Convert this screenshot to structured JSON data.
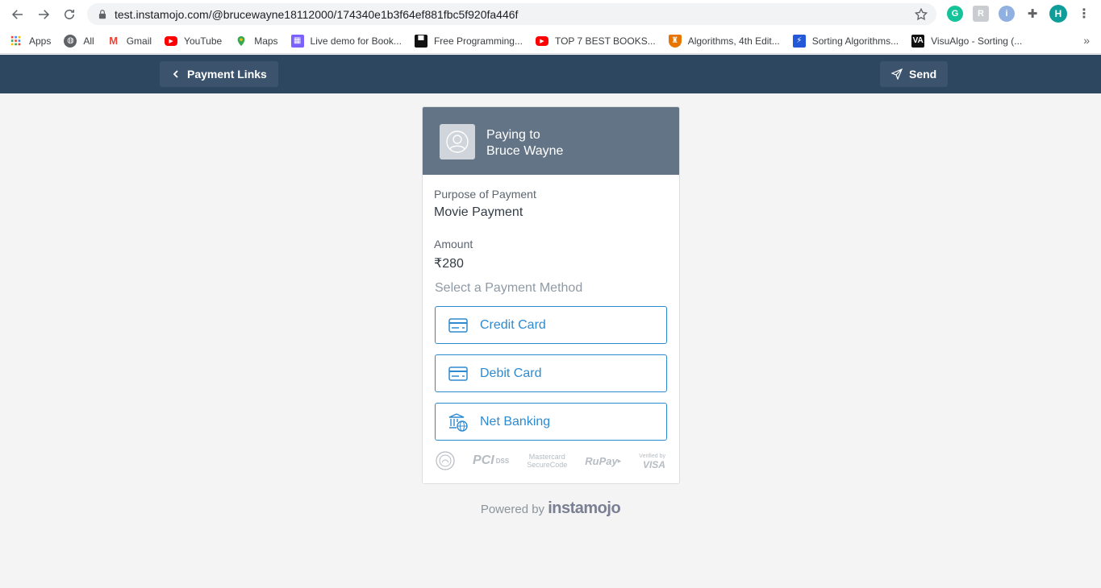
{
  "browser": {
    "url": "test.instamojo.com/@brucewayne18112000/174340e1b3f64ef881fbc5f920fa446f",
    "profile_initial": "H",
    "bookmarks": [
      {
        "label": "Apps",
        "icon": "apps-grid-icon"
      },
      {
        "label": "All",
        "icon": "globe-icon"
      },
      {
        "label": "Gmail",
        "icon": "gmail-icon"
      },
      {
        "label": "YouTube",
        "icon": "youtube-icon"
      },
      {
        "label": "Maps",
        "icon": "maps-pin-icon"
      },
      {
        "label": "Live demo for Book...",
        "icon": "calendar-icon"
      },
      {
        "label": "Free Programming...",
        "icon": "square-logo-icon"
      },
      {
        "label": "TOP 7 BEST BOOKS...",
        "icon": "youtube-icon"
      },
      {
        "label": "Algorithms, 4th Edit...",
        "icon": "shield-icon"
      },
      {
        "label": "Sorting Algorithms...",
        "icon": "bookmark-blue-icon"
      },
      {
        "label": "VisuAlgo - Sorting (...",
        "icon": "visualgo-icon"
      }
    ],
    "more_symbol": "»"
  },
  "header": {
    "back_label": "Payment Links",
    "send_label": "Send"
  },
  "card": {
    "paying_to_line1": "Paying to",
    "paying_to_line2": "Bruce Wayne",
    "purpose_label": "Purpose of Payment",
    "purpose_value": "Movie Payment",
    "amount_label": "Amount",
    "amount_currency": "₹",
    "amount_value": "280",
    "select_method_label": "Select a Payment Method",
    "methods": [
      {
        "label": "Credit Card",
        "icon": "credit-card-icon"
      },
      {
        "label": "Debit Card",
        "icon": "debit-card-icon"
      },
      {
        "label": "Net Banking",
        "icon": "bank-globe-icon"
      }
    ],
    "badges": {
      "pci": "PCI",
      "pci_dss": "DSS",
      "mastercard_line1": "Mastercard",
      "mastercard_line2": "SecureCode",
      "rupay": "RuPay",
      "visa_line1": "Verified by",
      "visa_line2": "VISA"
    }
  },
  "footer": {
    "powered_by": "Powered by",
    "brand": "instamojo"
  },
  "colors": {
    "header_bg": "#2e4760",
    "card_head_bg": "#647487",
    "accent": "#2e8ad0",
    "page_bg": "#f3f4f3"
  }
}
